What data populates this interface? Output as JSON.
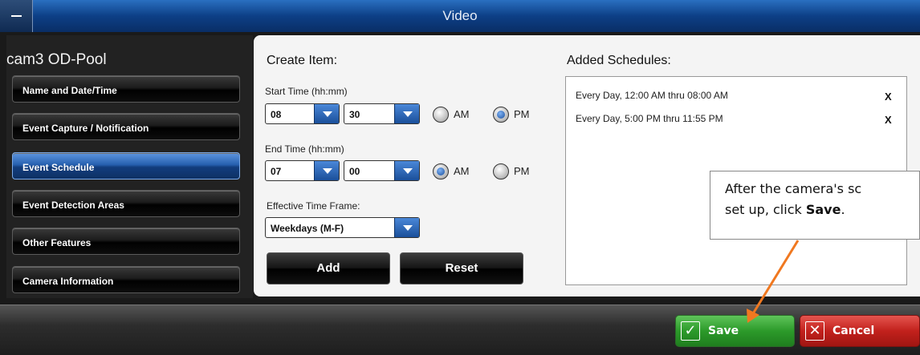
{
  "window": {
    "title": "Video"
  },
  "camera": {
    "name": "cam3 OD-Pool"
  },
  "sidebar": {
    "items": [
      {
        "label": "Name and Date/Time"
      },
      {
        "label": "Event Capture / Notification"
      },
      {
        "label": "Event Schedule"
      },
      {
        "label": "Event Detection Areas"
      },
      {
        "label": "Other Features"
      },
      {
        "label": "Camera Information"
      }
    ],
    "active_index": 2
  },
  "create_item": {
    "heading": "Create Item:",
    "start_time": {
      "label": "Start Time (hh:mm)",
      "hour": "08",
      "minute": "30",
      "am_label": "AM",
      "pm_label": "PM",
      "selected": "PM"
    },
    "end_time": {
      "label": "End Time (hh:mm)",
      "hour": "07",
      "minute": "00",
      "am_label": "AM",
      "pm_label": "PM",
      "selected": "AM"
    },
    "time_frame": {
      "label": "Effective Time Frame:",
      "value": "Weekdays (M-F)"
    },
    "add_label": "Add",
    "reset_label": "Reset"
  },
  "schedules": {
    "heading": "Added Schedules:",
    "items": [
      {
        "text": "Every Day, 12:00 AM thru 08:00 AM",
        "remove": "X"
      },
      {
        "text": "Every Day, 5:00 PM thru 11:55 PM",
        "remove": "X"
      }
    ]
  },
  "callout": {
    "line1": "After the camera's sc",
    "line2_prefix": "set up, click ",
    "line2_bold": "Save",
    "line2_suffix": "."
  },
  "footer": {
    "save_label": "Save",
    "cancel_label": "Cancel"
  },
  "colors": {
    "accent": "#1f5cb0",
    "save": "#2c9a2a",
    "cancel": "#c2211c",
    "annotation_arrow": "#f07820"
  }
}
